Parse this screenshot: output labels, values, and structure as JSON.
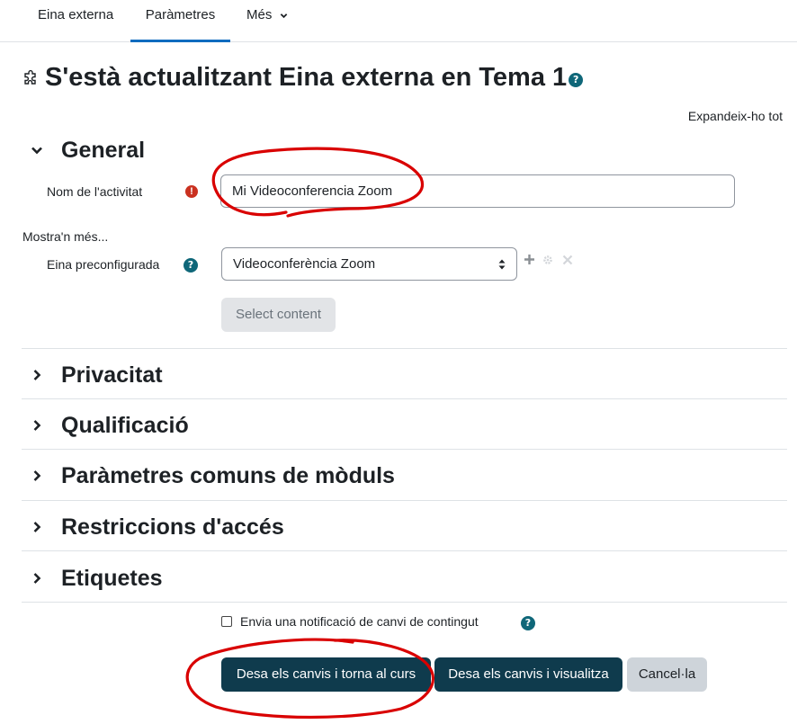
{
  "nav": {
    "tabs": [
      {
        "label": "Eina externa"
      },
      {
        "label": "Paràmetres"
      },
      {
        "label": "Més"
      }
    ]
  },
  "page": {
    "title": "S'està actualitzant Eina externa en Tema 1",
    "expand_all": "Expandeix-ho tot"
  },
  "general": {
    "heading": "General",
    "activity_name_label": "Nom de l'activitat",
    "activity_name_value": "Mi Videoconferencia Zoom",
    "show_more": "Mostra'n més...",
    "preconfigured_label": "Eina preconfigurada",
    "preconfigured_value": "Videoconferència Zoom",
    "select_content": "Select content"
  },
  "sections": [
    {
      "label": "Privacitat"
    },
    {
      "label": "Qualificació"
    },
    {
      "label": "Paràmetres comuns de mòduls"
    },
    {
      "label": "Restriccions d'accés"
    },
    {
      "label": "Etiquetes"
    }
  ],
  "notification": {
    "label": "Envia una notificació de canvi de contingut",
    "checked": false
  },
  "buttons": {
    "save_return": "Desa els canvis i torna al curs",
    "save_display": "Desa els canvis i visualitza",
    "cancel": "Cancel·la"
  },
  "colors": {
    "primary": "#0f3b4d",
    "help_icon": "#0f6779",
    "required": "#ca3120",
    "annotation": "#d90000",
    "active_tab": "#0f6cbf"
  },
  "icons": {
    "title": "puzzle-icon",
    "help": "question-circle-icon",
    "required": "exclamation-circle-icon",
    "expand": "chevron-right-icon",
    "collapse": "chevron-down-icon",
    "add": "plus-icon",
    "configure": "gear-icon",
    "delete": "close-icon"
  }
}
